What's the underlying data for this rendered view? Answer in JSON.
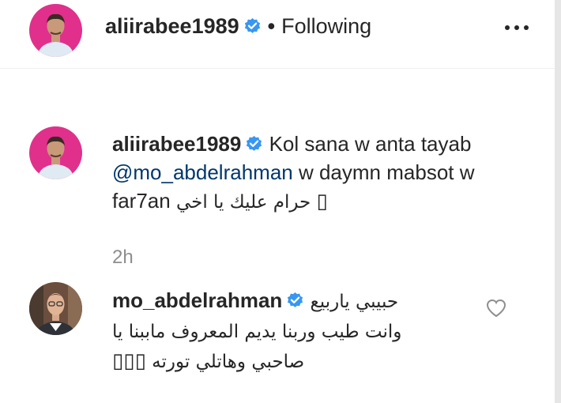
{
  "header": {
    "username": "aliirabee1989",
    "separator": "•",
    "follow_status": "Following",
    "more_icon": "more-options-icon"
  },
  "caption": {
    "username": "aliirabee1989",
    "text_before_mention": "Kol sana w anta tayab ",
    "mention": "@mo_abdelrahman",
    "text_after_mention": " w daymn mabsot w far7an ",
    "arabic_text": "حرام عليك يا اخي",
    "emoji_placeholder": "▯",
    "time": "2h"
  },
  "comment": {
    "username": "mo_abdelrahman",
    "arabic_line1": "حبيبي ياربيع",
    "arabic_line2": "وانت طيب وربنا يديم المعروف ماببنا يا",
    "arabic_line3": "صاحبي وهاتلي تورته",
    "emoji_placeholders": "▯▯▯",
    "like_icon": "heart-icon"
  },
  "colors": {
    "text": "#262626",
    "secondary": "#8e8e8e",
    "mention": "#00376b",
    "verified_badge": "#3897f0",
    "avatar_bg_pink": "#e0308c"
  }
}
